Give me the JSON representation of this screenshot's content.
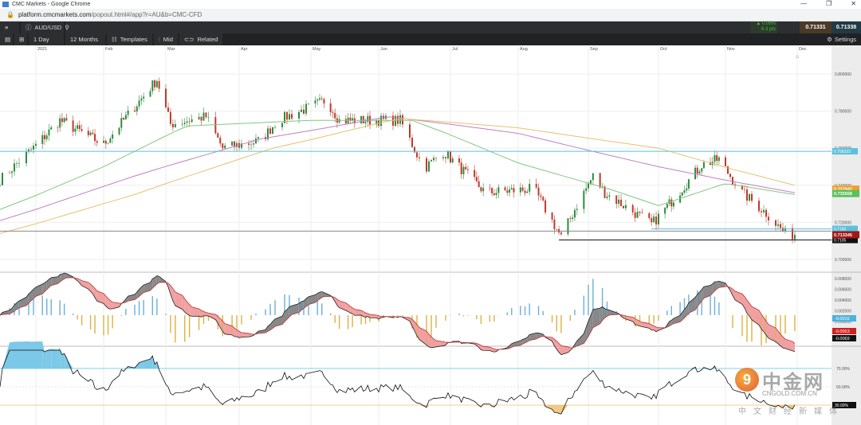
{
  "window": {
    "title": "CMC Markets - Google Chrome",
    "controls": [
      "—",
      "❐",
      "✕"
    ]
  },
  "address": {
    "host": "platform.cmcmarkets.com",
    "path": "/popout.html#/app?r=AU&b=CMC-CFD"
  },
  "toolbar": {
    "instrument": "AUD/USD",
    "change_pct": "▲ 0.08%",
    "change_pts": "6.3 pts",
    "bid": "0.71331",
    "ask": "0.71338"
  },
  "toolbar2": {
    "interval": "1 Day",
    "range": "12 Months",
    "templates": "Templates",
    "price_type": "Mid",
    "related": "Related",
    "settings": "Settings"
  },
  "colors": {
    "up": "#2e8b3e",
    "down": "#c0392b",
    "ma_short": "#7fc97f",
    "ma_mid": "#c080c0",
    "ma_long": "#e8c070",
    "level": "#5bc0de"
  },
  "chart_data": {
    "type": "candlestick",
    "months": [
      "2021",
      "Feb",
      "Mar",
      "Apr",
      "May",
      "Jun",
      "Jul",
      "Aug",
      "Sep",
      "Oct",
      "Nov",
      "Dec"
    ],
    "price_axis": [
      "0.800000",
      "0.780000",
      "0.760000",
      "0.740000",
      "0.720000",
      "0.700000"
    ],
    "ylim": [
      0.694,
      0.812
    ],
    "close_path": [
      [
        "2020-12-17",
        0.743
      ],
      [
        "2021-01-12",
        0.775
      ],
      [
        "2021-02-01",
        0.762
      ],
      [
        "2021-02-25",
        0.797
      ],
      [
        "2021-03-03",
        0.773
      ],
      [
        "2021-03-18",
        0.777
      ],
      [
        "2021-03-25",
        0.76
      ],
      [
        "2021-04-10",
        0.764
      ],
      [
        "2021-04-17",
        0.775
      ],
      [
        "2021-05-08",
        0.786
      ],
      [
        "2021-05-14",
        0.775
      ],
      [
        "2021-06-10",
        0.775
      ],
      [
        "2021-06-20",
        0.749
      ],
      [
        "2021-06-28",
        0.758
      ],
      [
        "2021-07-17",
        0.736
      ],
      [
        "2021-08-08",
        0.738
      ],
      [
        "2021-08-20",
        0.712
      ],
      [
        "2021-08-26",
        0.727
      ],
      [
        "2021-09-03",
        0.745
      ],
      [
        "2021-09-08",
        0.736
      ],
      [
        "2021-09-28",
        0.719
      ],
      [
        "2021-10-06",
        0.73
      ],
      [
        "2021-10-21",
        0.751
      ],
      [
        "2021-10-29",
        0.754
      ],
      [
        "2021-11-08",
        0.736
      ],
      [
        "2021-11-18",
        0.725
      ],
      [
        "2021-11-26",
        0.714
      ],
      [
        "2021-11-30",
        0.7133
      ]
    ],
    "moving_averages": [
      {
        "color": "#7fc97f",
        "points": [
          [
            "2020-12-17",
            0.727
          ],
          [
            "2021-02-01",
            0.75
          ],
          [
            "2021-03-10",
            0.772
          ],
          [
            "2021-05-01",
            0.775
          ],
          [
            "2021-06-15",
            0.775
          ],
          [
            "2021-08-01",
            0.752
          ],
          [
            "2021-09-10",
            0.738
          ],
          [
            "2021-10-01",
            0.729
          ],
          [
            "2021-11-01",
            0.741
          ],
          [
            "2021-11-30",
            0.735
          ]
        ]
      },
      {
        "color": "#c080c0",
        "points": [
          [
            "2020-12-17",
            0.721
          ],
          [
            "2021-02-15",
            0.745
          ],
          [
            "2021-04-10",
            0.765
          ],
          [
            "2021-06-05",
            0.777
          ],
          [
            "2021-08-01",
            0.768
          ],
          [
            "2021-10-01",
            0.75
          ],
          [
            "2021-11-30",
            0.736
          ]
        ]
      },
      {
        "color": "#e8c070",
        "points": [
          [
            "2020-12-17",
            0.714
          ],
          [
            "2021-02-15",
            0.735
          ],
          [
            "2021-04-15",
            0.76
          ],
          [
            "2021-06-10",
            0.776
          ],
          [
            "2021-08-01",
            0.771
          ],
          [
            "2021-10-01",
            0.76
          ],
          [
            "2021-11-30",
            0.74
          ]
        ]
      }
    ],
    "levels": [
      {
        "value": 0.758333,
        "label": "0.758333",
        "color": "#5bc0de",
        "from": "2020-12-17"
      },
      {
        "value": 0.7165,
        "label": "0.7165",
        "color": "#5bc0de",
        "from": "2021-09-28"
      },
      {
        "value": 0.7153,
        "label": "",
        "color": "#888888",
        "from": "2020-12-17"
      },
      {
        "value": 0.7105,
        "label": "0.7105",
        "color": "#111111",
        "from": "2021-08-19"
      }
    ],
    "tags": [
      {
        "value": 0.737942,
        "label": "0.737942",
        "color": "#f0a030"
      },
      {
        "value": 0.735558,
        "label": "0.735558",
        "color": "#5cc05c"
      },
      {
        "value": 0.713345,
        "label": "0.713345",
        "color": "#a01818"
      }
    ],
    "macd_axis": [
      "0.008000",
      "0.006000",
      "0.004000",
      "0.002000",
      "0.000000"
    ],
    "macd_tags": [
      {
        "label": "-0.0016",
        "color": "#4fb0e0"
      },
      {
        "label": "-0.0053",
        "color": "#d02020"
      },
      {
        "label": "-0.0069",
        "color": "#111111"
      }
    ],
    "rsi_axis": [
      "70.00%",
      "50.00%"
    ],
    "rsi_tag": "30.00%"
  },
  "logo": {
    "name": "中金网",
    "domain": "CNGOLD.COM.CN",
    "tagline": "中文财经新媒体"
  }
}
